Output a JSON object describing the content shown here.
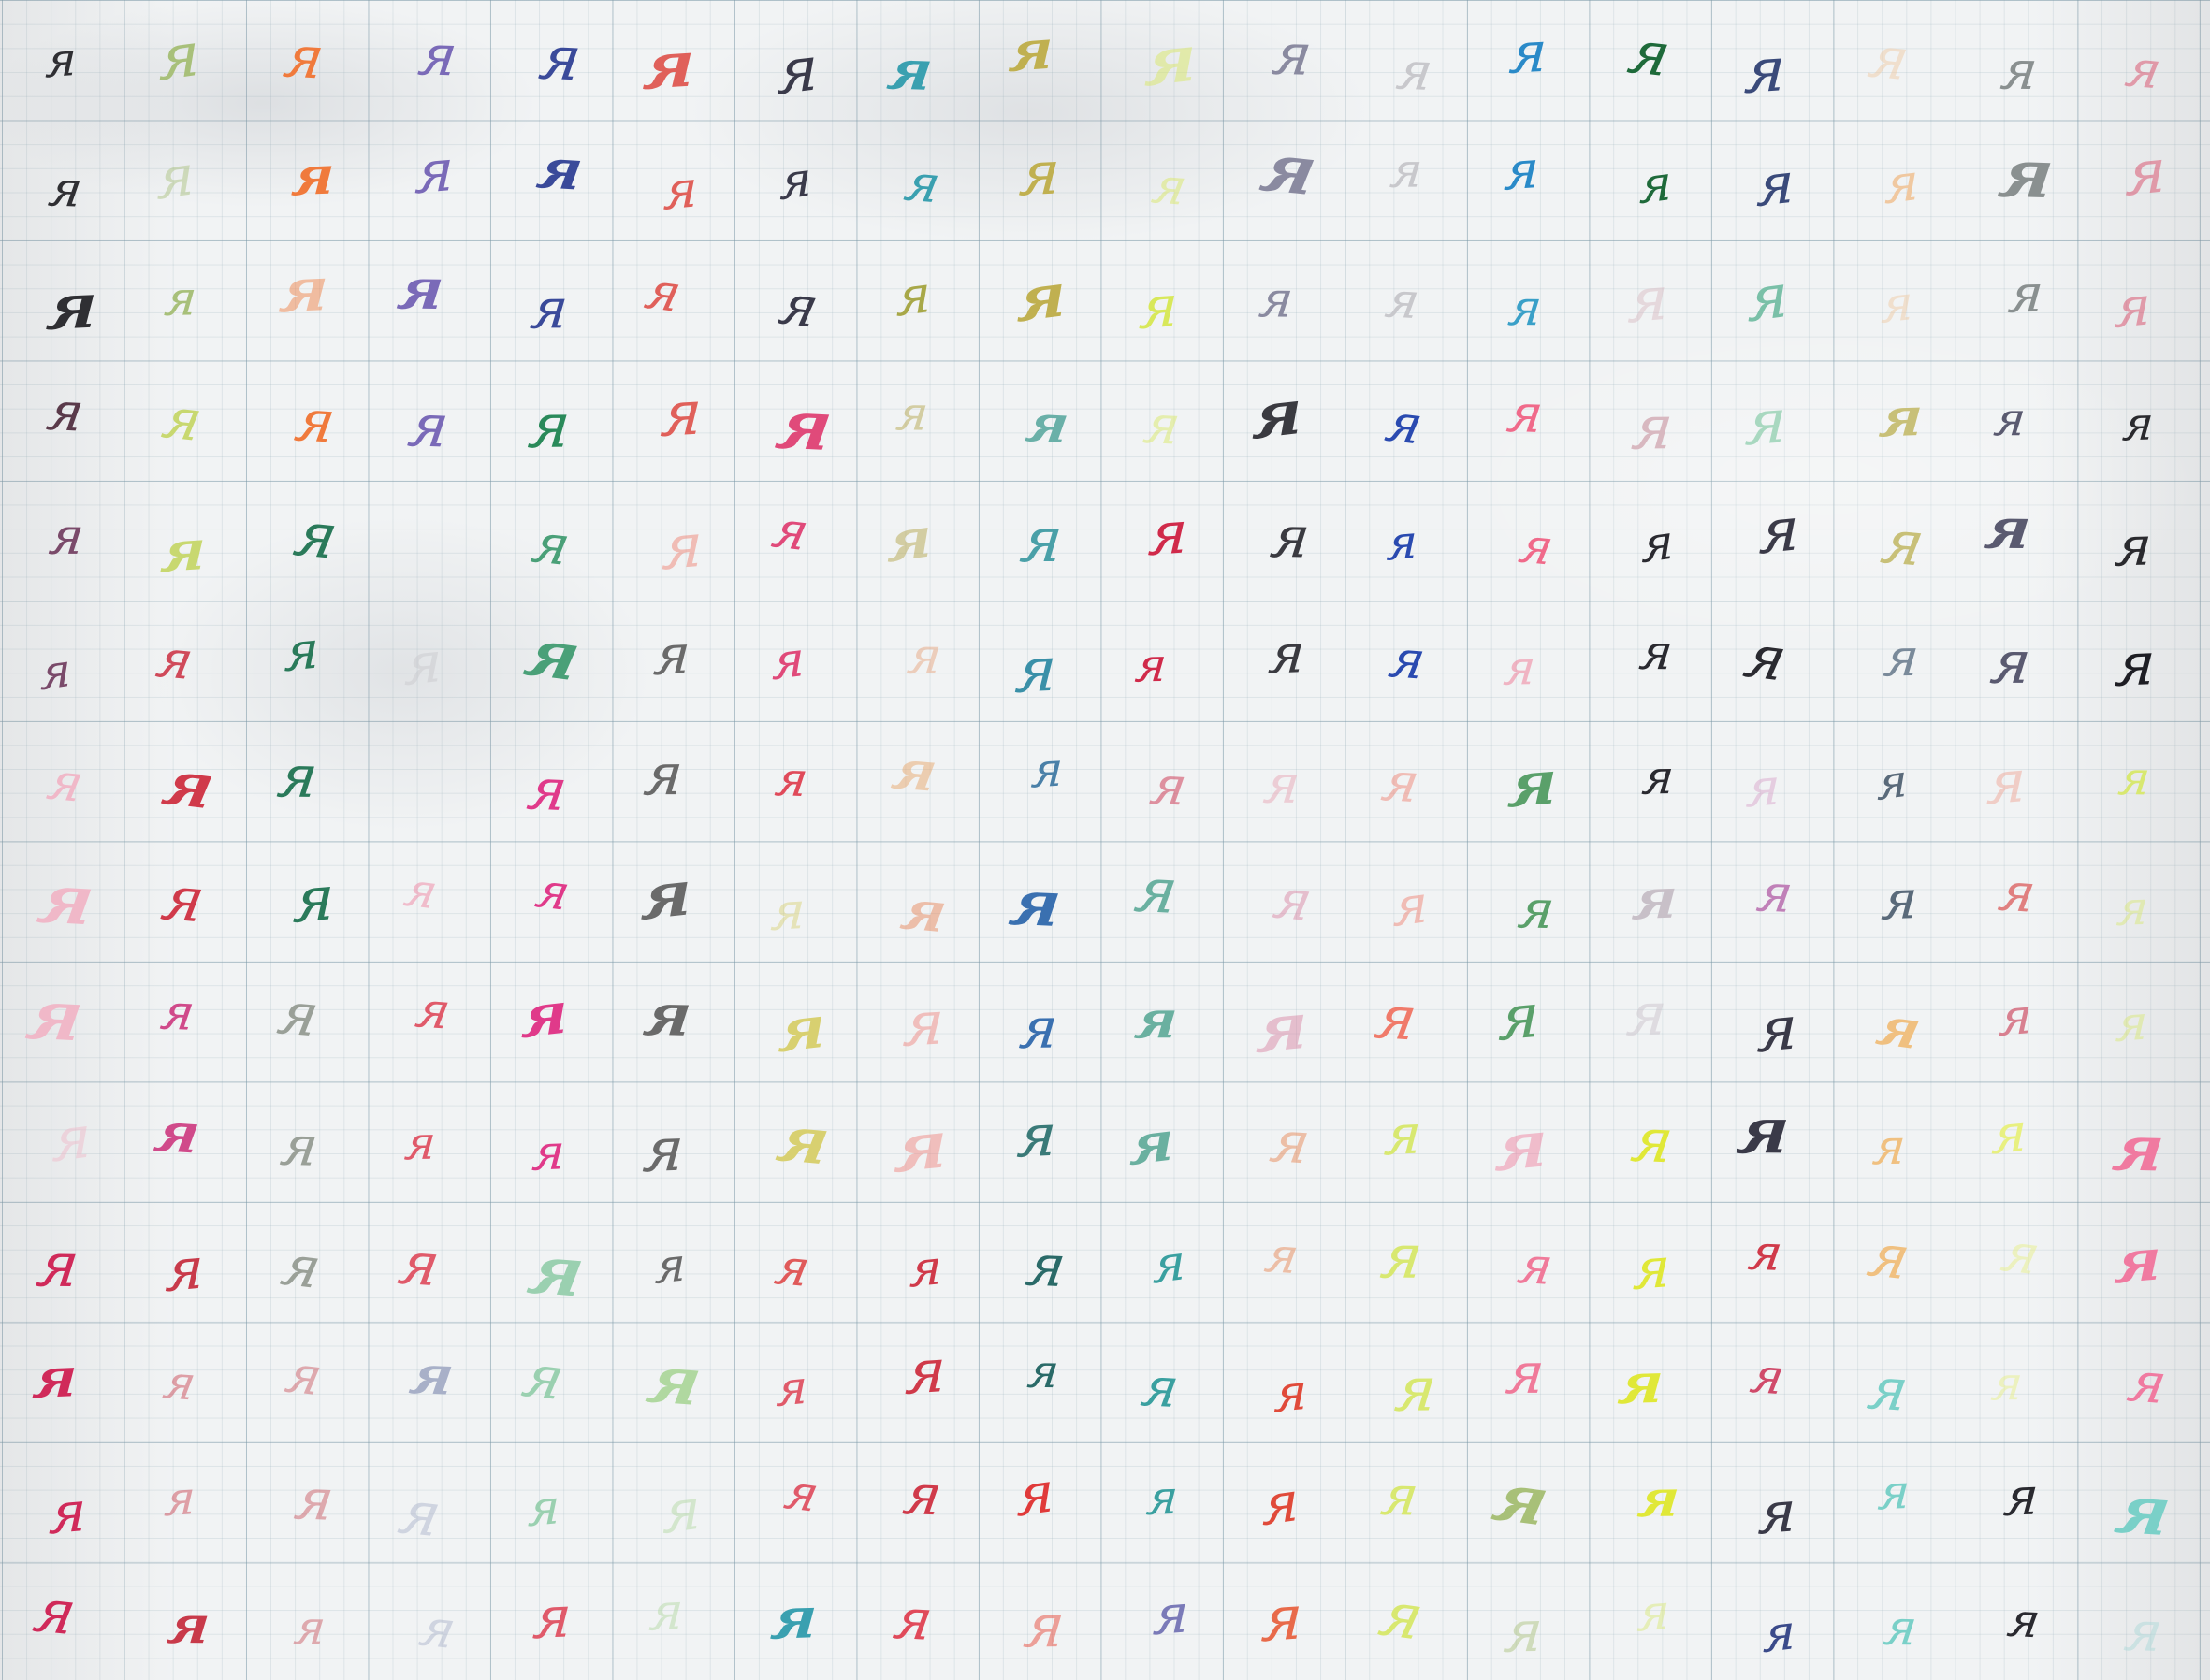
{
  "sheet": {
    "grid_rows": 14,
    "grid_cols": 18,
    "letter": "я",
    "rows": [
      [
        "#2f2f33",
        "#a8c07a",
        "#f07a3c",
        "#7a6ab8",
        "#3a4a9a",
        "#e0605a",
        "#3a3a4a",
        "#3aa0b0",
        "#c0b050",
        "#d8e85a",
        "#8a8aa0",
        "#c8c8cc",
        "#2a8ac8",
        "#1e6a3a",
        "#3a4a7a",
        "#f0c8a0",
        "#8a9090",
        "#d83a5a"
      ],
      [
        "#2f2f33",
        "#a8c07a",
        "#f07a3c",
        "#7a6ab8",
        "#3a4a9a",
        "#e0605a",
        "#3a3a4a",
        "#3aa0b0",
        "#c0b050",
        "#d8e85a",
        "#8a8aa0",
        "#c8c8cc",
        "#2a8ac8",
        "#1e6a3a",
        "#3a4a7a",
        "#f0c8a0",
        "#8a9090",
        "#d83a5a"
      ],
      [
        "#2f2f33",
        "#a8c07a",
        "#f07a3c",
        "#7a6ab8",
        "#3a4a9a",
        "#e0605a",
        "#3a3a4a",
        "#a8a848",
        "#c0b050",
        "#d8e85a",
        "#8a8aa0",
        "#c8c8cc",
        "#3aa0c8",
        "#d8b8c0",
        "#7ac0a8",
        "#f0c8a0",
        "#8a9090",
        "#d83a5a"
      ],
      [
        "#5a3a4a",
        "#c8d870",
        "#f07a3c",
        "#7a6ab8",
        "#2a8a5a",
        "#e0605a",
        "#e04a7a",
        "#b0a040",
        "#6ab0a8",
        "#d8e85a",
        "#3a3a40",
        "#2a4ab0",
        "#f06a8a",
        "#d8b8c0",
        "#a8d8c0",
        "#c8c078",
        "#5a5a70",
        "#2a2a2e"
      ],
      [
        "#7a4a6a",
        "#c8d870",
        "#2a7a5a",
        "#c8c8cc",
        "#4aa078",
        "#f07a6a",
        "#e04a7a",
        "#b0a040",
        "#4aa0a8",
        "#d02a4a",
        "#3a3a40",
        "#2a4ab0",
        "#f06a8a",
        "#2a2a30",
        "#3a3a48",
        "#c8c078",
        "#5a5a70",
        "#2a2a2e"
      ],
      [
        "#7a4a6a",
        "#d04a5a",
        "#2a7a5a",
        "#c8c8cc",
        "#4aa078",
        "#6a6a6a",
        "#e04a7a",
        "#e8a078",
        "#3a90a8",
        "#d02a4a",
        "#3a3a40",
        "#2a4ab0",
        "#f06a8a",
        "#2a2a30",
        "#2a2a30",
        "#7a8a9a",
        "#5a5a70",
        "#1e1e24"
      ],
      [
        "#f0b8c8",
        "#d03a4a",
        "#2a7a5a",
        "#c8c8cc",
        "#e03a8a",
        "#6a6a6a",
        "#e04a5a",
        "#e8a060",
        "#4a80a8",
        "#c81a3a",
        "#e8a0b0",
        "#f07a6a",
        "#5aa06a",
        "#2a2a30",
        "#d8a0c8",
        "#5a6a7a",
        "#f0a090",
        "#d8e870"
      ],
      [
        "#f0b8c8",
        "#d03a4a",
        "#2a7a5a",
        "#f07a9a",
        "#e03a8a",
        "#6a6a6a",
        "#d8d070",
        "#e88050",
        "#3a70b0",
        "#6ab0a0",
        "#d880a0",
        "#f07a6a",
        "#5aa06a",
        "#c8c0c8",
        "#c080b8",
        "#5a6a7a",
        "#e08080",
        "#d8e870"
      ],
      [
        "#f0b8c8",
        "#d04a8a",
        "#9aa098",
        "#e05a6a",
        "#e03a8a",
        "#6a6a6a",
        "#d8d070",
        "#f0807a",
        "#3a70b0",
        "#6ab0a0",
        "#d880a0",
        "#f07a6a",
        "#5aa06a",
        "#c8c0c8",
        "#3a3a48",
        "#f0c080",
        "#d88090",
        "#d8e870"
      ],
      [
        "#f0b8c8",
        "#d04a8a",
        "#9aa098",
        "#e05a6a",
        "#e03a8a",
        "#6a6a6a",
        "#d8d070",
        "#f0807a",
        "#3a7a78",
        "#6ab0a0",
        "#e8804a",
        "#d8e870",
        "#f07a9a",
        "#e0e838",
        "#3a3a48",
        "#f0c080",
        "#e8f080",
        "#f07aa0"
      ],
      [
        "#d02a5a",
        "#c83a4a",
        "#9aa098",
        "#e05a6a",
        "#9ad0b0",
        "#6a6a6a",
        "#e05a5a",
        "#d03a4a",
        "#2a6a68",
        "#3aa0a0",
        "#e8804a",
        "#d8e870",
        "#f07a9a",
        "#e0e838",
        "#d03a4a",
        "#f0c080",
        "#e8f080",
        "#f07aa0"
      ],
      [
        "#d02a5a",
        "#c83a4a",
        "#c8505a",
        "#a8b0c8",
        "#9ad0b0",
        "#b0d8a0",
        "#e05a6a",
        "#d03a4a",
        "#2a6a68",
        "#3aa0a0",
        "#e04a3a",
        "#d8e870",
        "#f07a9a",
        "#e0e838",
        "#d04a6a",
        "#7ad0c8",
        "#e8f080",
        "#f07aa0"
      ],
      [
        "#d02a5a",
        "#c83a4a",
        "#c8505a",
        "#a8b0c8",
        "#9ad0b0",
        "#b0d8a0",
        "#e05a6a",
        "#d03a4a",
        "#e03a3a",
        "#3aa0a0",
        "#e04a3a",
        "#d8e870",
        "#a8c078",
        "#e0e838",
        "#3a3a48",
        "#7ad0c8",
        "#2a2a30",
        "#7ad0c8"
      ],
      [
        "#d02a5a",
        "#c83a4a",
        "#c8505a",
        "#a8b0c8",
        "#e05a6a",
        "#b0d8a0",
        "#3aa0b0",
        "#e04a5a",
        "#e83a2a",
        "#7a7ab8",
        "#e86a4a",
        "#d8e870",
        "#a8c078",
        "#d8e870",
        "#3a4a8a",
        "#7ad0c8",
        "#2a2a30",
        "#a8d8d8"
      ]
    ],
    "blank_cells": [
      [
        6,
        3
      ],
      [
        4,
        3
      ]
    ]
  }
}
